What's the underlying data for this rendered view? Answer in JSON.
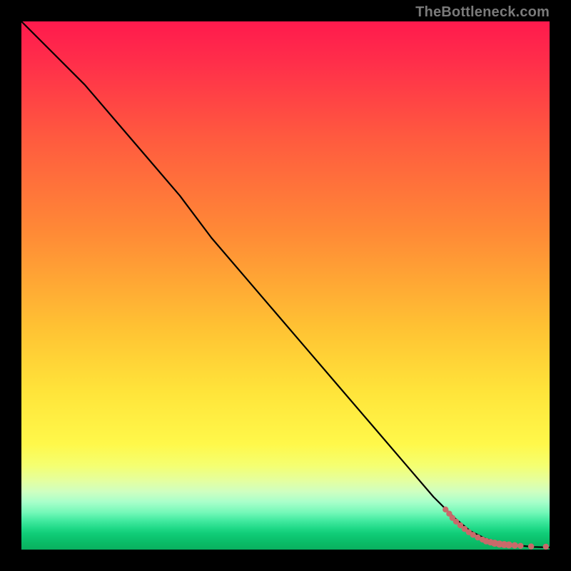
{
  "watermark": "TheBottleneck.com",
  "chart_data": {
    "type": "line",
    "title": "",
    "xlabel": "",
    "ylabel": "",
    "xlim": [
      0,
      100
    ],
    "ylim": [
      0,
      100
    ],
    "series": [
      {
        "name": "curve",
        "x": [
          0,
          6,
          12,
          18,
          24,
          30,
          36,
          42,
          48,
          54,
          60,
          66,
          72,
          78,
          82,
          85,
          88,
          91,
          94,
          97,
          100
        ],
        "y": [
          100,
          94,
          88,
          81,
          74,
          67,
          59,
          52,
          45,
          38,
          31,
          24,
          17,
          10,
          6,
          3.5,
          2,
          1.2,
          0.8,
          0.5,
          0.4
        ]
      }
    ],
    "scatter": {
      "name": "points",
      "color": "#c86a6a",
      "x": [
        80.3,
        81.0,
        81.6,
        82.3,
        83.1,
        83.9,
        84.7,
        85.5,
        86.4,
        87.3,
        88.0,
        88.8,
        89.6,
        90.5,
        91.4,
        92.3,
        93.4,
        94.5,
        96.5,
        99.3
      ],
      "y": [
        7.6,
        6.8,
        6.0,
        5.3,
        4.6,
        3.9,
        3.3,
        2.8,
        2.3,
        1.9,
        1.6,
        1.4,
        1.2,
        1.05,
        0.95,
        0.88,
        0.8,
        0.7,
        0.6,
        0.55
      ],
      "r": [
        4.2,
        4.2,
        4.2,
        4.2,
        4.2,
        4.2,
        4.2,
        4.2,
        4.2,
        4.2,
        4.6,
        4.6,
        5.0,
        5.0,
        5.0,
        5.0,
        4.6,
        4.2,
        4.2,
        4.2
      ]
    }
  }
}
